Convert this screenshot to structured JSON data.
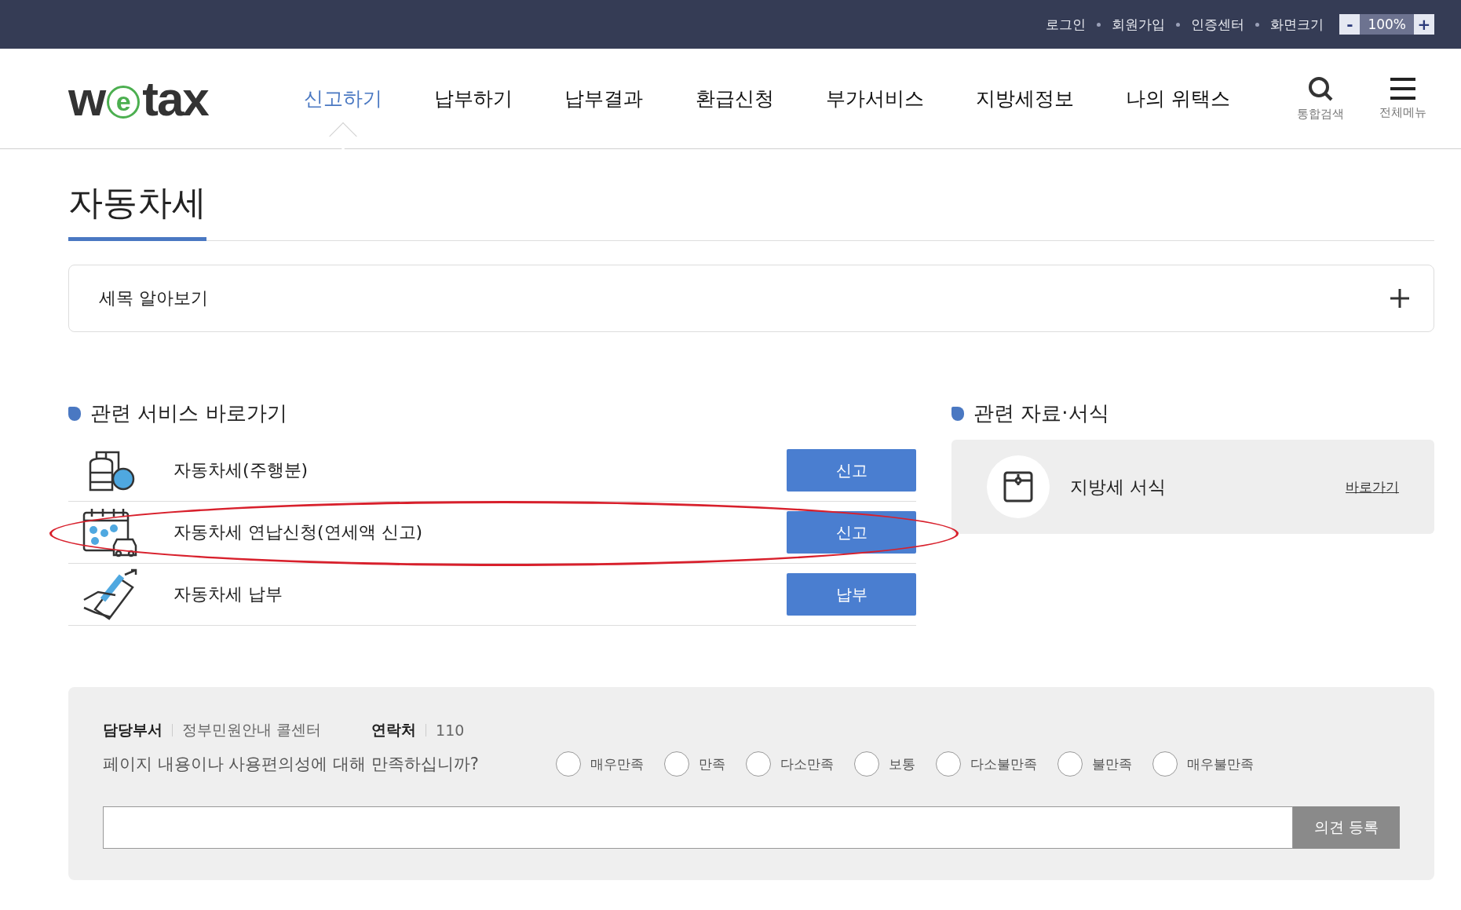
{
  "top_bar": {
    "links": [
      "로그인",
      "회원가입",
      "인증센터"
    ],
    "zoom_label": "화면크기",
    "zoom_minus": "-",
    "zoom_value": "100%",
    "zoom_plus": "+"
  },
  "header": {
    "logo": [
      "w",
      "e",
      "tax"
    ],
    "nav": [
      {
        "label": "신고하기",
        "selected": true
      },
      {
        "label": "납부하기",
        "selected": false
      },
      {
        "label": "납부결과",
        "selected": false
      },
      {
        "label": "환급신청",
        "selected": false
      },
      {
        "label": "부가서비스",
        "selected": false
      },
      {
        "label": "지방세정보",
        "selected": false
      },
      {
        "label": "나의 위택스",
        "selected": false
      }
    ],
    "search_label": "통합검색",
    "menu_label": "전체메뉴"
  },
  "page_title": "자동차세",
  "accordion": {
    "label": "세목 알아보기",
    "expanded": false
  },
  "services": {
    "title": "관련 서비스 바로가기",
    "rows": [
      {
        "kind": "oil",
        "label": "자동차세(주행분)",
        "button": "신고",
        "highlighted": false
      },
      {
        "kind": "calendar",
        "label": "자동차세 연납신청(연세액 신고)",
        "button": "신고",
        "highlighted": true
      },
      {
        "kind": "card",
        "label": "자동차세 납부",
        "button": "납부",
        "highlighted": false
      }
    ]
  },
  "resources": {
    "title": "관련 자료·서식",
    "items": [
      {
        "label": "지방세 서식",
        "link": "바로가기"
      }
    ]
  },
  "footer": {
    "dept_label": "담당부서",
    "dept": "정부민원안내 콜센터",
    "contact_label": "연락처",
    "contact": "110",
    "question": "페이지 내용이나 사용편의성에 대해 만족하십니까?",
    "options": [
      {
        "label": "매우만족",
        "selected": false
      },
      {
        "label": "만족",
        "selected": false
      },
      {
        "label": "다소만족",
        "selected": false
      },
      {
        "label": "보통",
        "selected": false
      },
      {
        "label": "다소불만족",
        "selected": false
      },
      {
        "label": "불만족",
        "selected": false
      },
      {
        "label": "매우불만족",
        "selected": false
      }
    ],
    "submit": "의견 등록"
  }
}
